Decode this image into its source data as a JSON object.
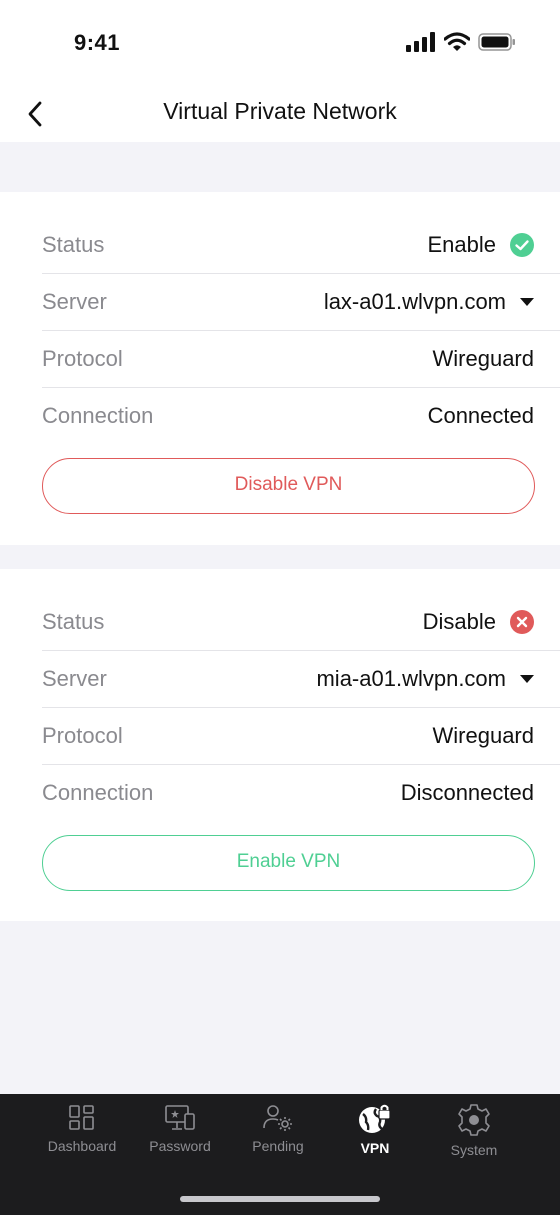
{
  "status_bar": {
    "time": "9:41"
  },
  "header": {
    "title": "Virtual Private Network"
  },
  "vpns": [
    {
      "status_label": "Status",
      "status_value": "Enable",
      "server_label": "Server",
      "server_value": "lax-a01.wlvpn.com",
      "protocol_label": "Protocol",
      "protocol_value": "Wireguard",
      "connection_label": "Connection",
      "connection_value": "Connected",
      "button_label": "Disable VPN"
    },
    {
      "status_label": "Status",
      "status_value": "Disable",
      "server_label": "Server",
      "server_value": "mia-a01.wlvpn.com",
      "protocol_label": "Protocol",
      "protocol_value": "Wireguard",
      "connection_label": "Connection",
      "connection_value": "Disconnected",
      "button_label": "Enable VPN"
    }
  ],
  "tabs": [
    {
      "label": "Dashboard",
      "icon": "dashboard-icon"
    },
    {
      "label": "Password",
      "icon": "password-icon"
    },
    {
      "label": "Pending",
      "icon": "pending-icon"
    },
    {
      "label": "VPN",
      "icon": "vpn-globe-lock-icon",
      "active": true
    },
    {
      "label": "System",
      "icon": "gear-icon"
    }
  ],
  "colors": {
    "enabled": "#4fcf93",
    "disabled": "#e05a5a",
    "tab_bar": "#1c1c1e"
  }
}
